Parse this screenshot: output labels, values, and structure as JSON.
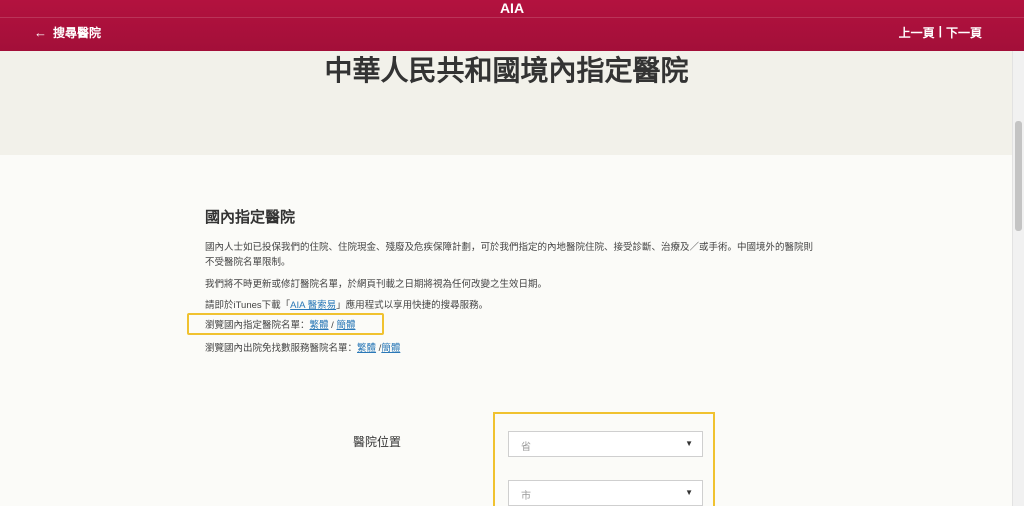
{
  "header": {
    "brand": "AIA",
    "back_label": "搜尋醫院",
    "prev_label": "上一頁",
    "separator": "|",
    "next_label": "下一頁"
  },
  "page_title": "中華人民共和國境內指定醫院",
  "section": {
    "title": "國內指定醫院",
    "paragraphs": {
      "p1": "國內人士如已投保我們的住院、住院現金、殘廢及危疾保障計劃，可於我們指定的內地醫院住院、接受診斷、治療及／或手術。中國境外的醫院則不受醫院名單限制。",
      "p2": "我們將不時更新或修訂醫院名單，於網頁刊載之日期將視為任何改變之生效日期。",
      "p3_before": "請即於iTunes下載「",
      "p3_link": "AIA 醫索易",
      "p3_after": "」應用程式以享用快捷的搜尋服務。",
      "p4_prefix": "瀏覽國內指定醫院名單：",
      "p4_link_trad": "繁體",
      "p4_sep": " / ",
      "p4_link_simp": "簡體",
      "p5_prefix": "瀏覽國內出院免找數服務醫院名單：",
      "p5_link_trad": "繁體",
      "p5_sep": " /",
      "p5_link_simp": "簡體"
    }
  },
  "location": {
    "label": "醫院位置",
    "province_placeholder": "省",
    "city_placeholder": "市"
  },
  "colors": {
    "header_red": "#a30f39",
    "highlight_yellow": "#f0c230",
    "link_blue": "#2a78b7",
    "hero_bg": "#f2f1ea"
  }
}
